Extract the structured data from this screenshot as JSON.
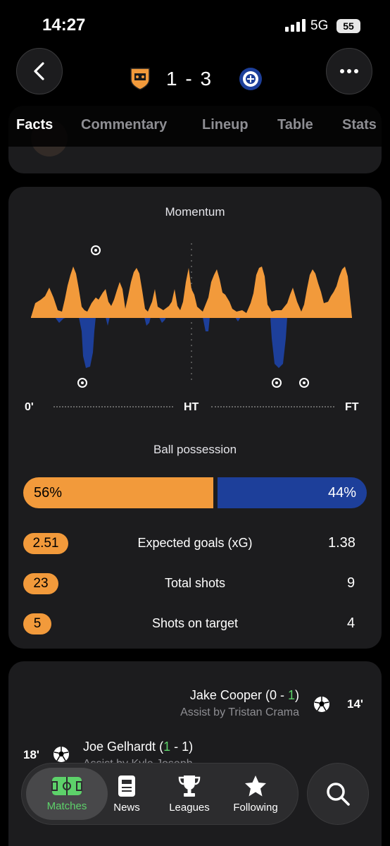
{
  "status": {
    "time": "14:27",
    "network": "5G",
    "battery": "55"
  },
  "match": {
    "score": "1 - 3"
  },
  "tabs": [
    "Facts",
    "Commentary",
    "Lineup",
    "Table",
    "Stats"
  ],
  "momentum": {
    "title": "Momentum",
    "labels": {
      "start": "0'",
      "half": "HT",
      "end": "FT"
    },
    "home_color": "#f29a3b",
    "away_color": "#1d3f9a"
  },
  "possession": {
    "title": "Ball possession",
    "home": "56%",
    "away": "44%",
    "home_fraction": 0.56
  },
  "stats": [
    {
      "label": "Expected goals (xG)",
      "home": "2.51",
      "away": "1.38"
    },
    {
      "label": "Total shots",
      "home": "23",
      "away": "9"
    },
    {
      "label": "Shots on target",
      "home": "5",
      "away": "4"
    }
  ],
  "events": {
    "goal1": {
      "player": "Jake Cooper",
      "score_prefix": " (0 - ",
      "score_hl": "1",
      "score_suffix": ")",
      "assist": "Assist by Tristan Crama",
      "minute": "14'"
    },
    "goal2": {
      "player": "Joe Gelhardt",
      "score_prefix": " (",
      "score_hl": "1",
      "score_suffix": " - 1)",
      "assist": "Assist by Kyle Joseph",
      "minute": "18'"
    }
  },
  "nav": [
    {
      "label": "Matches",
      "icon": "pitch-icon"
    },
    {
      "label": "News",
      "icon": "news-icon"
    },
    {
      "label": "Leagues",
      "icon": "trophy-icon"
    },
    {
      "label": "Following",
      "icon": "star-icon"
    }
  ],
  "colors": {
    "accent": "#f29a3b",
    "away": "#1d3f9a",
    "active_nav": "#5dd26a"
  }
}
